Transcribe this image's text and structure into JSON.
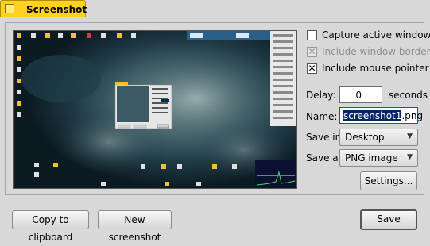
{
  "tab": {
    "title": "Screenshot"
  },
  "options": {
    "capture_active_window": {
      "label": "Capture active window",
      "checked": false
    },
    "include_window_border": {
      "label": "Include window border",
      "checked": true,
      "enabled": false
    },
    "include_mouse_pointer": {
      "label": "Include mouse pointer",
      "checked": true
    }
  },
  "delay": {
    "label": "Delay:",
    "value": "0",
    "unit": "seconds"
  },
  "name": {
    "label": "Name:",
    "selected": "screenshot1",
    "suffix": ".png"
  },
  "save_in": {
    "label": "Save in:",
    "value": "Desktop"
  },
  "save_as": {
    "label": "Save as:",
    "value": "PNG image"
  },
  "buttons": {
    "settings": "Settings...",
    "copy": "Copy to clipboard",
    "new": "New screenshot",
    "save": "Save"
  },
  "check_mark": "✕",
  "colors": {
    "tab": "#ffd21f",
    "selection": "#0a246a",
    "background": "#d8d8d8"
  }
}
